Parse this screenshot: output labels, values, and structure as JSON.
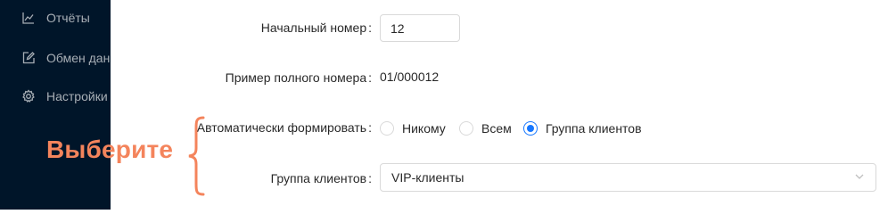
{
  "sidebar": {
    "items": [
      {
        "label": "Отчёты",
        "icon": "line-chart-icon"
      },
      {
        "label": "Обмен данными",
        "icon": "edit-square-icon"
      },
      {
        "label": "Настройки",
        "icon": "gear-icon"
      }
    ]
  },
  "form": {
    "start_number": {
      "label": "Начальный номер",
      "value": "12"
    },
    "example": {
      "label": "Пример полного номера",
      "value": "01/000012"
    },
    "auto_form": {
      "label": "Автоматически формировать",
      "options": [
        "Никому",
        "Всем",
        "Группа клиентов"
      ],
      "selected": "Группа клиентов"
    },
    "client_group": {
      "label": "Группа клиентов",
      "value": "VIP-клиенты"
    }
  },
  "annotation": {
    "text": "Выберите"
  },
  "colors": {
    "sidebar_bg": "#001529",
    "accent": "#1677ff",
    "annotation": "#f4845c"
  }
}
